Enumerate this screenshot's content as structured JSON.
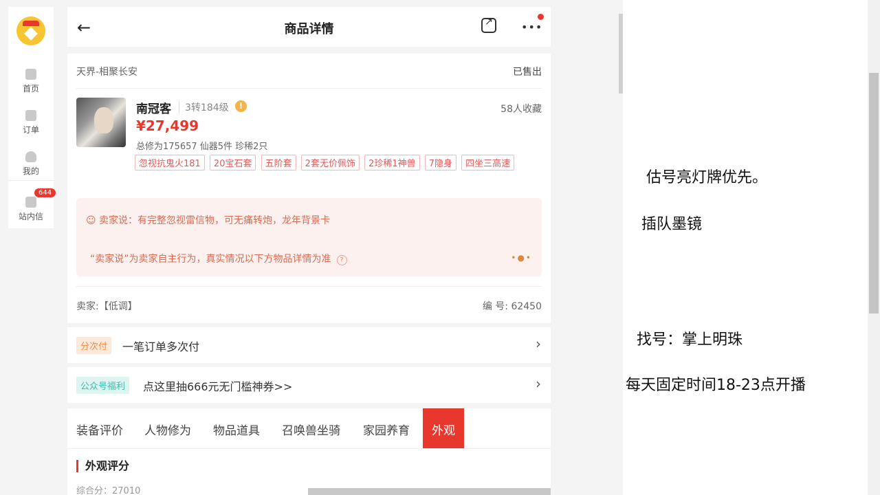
{
  "nav": {
    "items": [
      {
        "label": "首页",
        "icon": "home-icon"
      },
      {
        "label": "订单",
        "icon": "order-icon"
      },
      {
        "label": "我的",
        "icon": "user-icon"
      },
      {
        "label": "站内信",
        "icon": "mail-icon",
        "badge": "644"
      }
    ]
  },
  "header": {
    "title": "商品详情",
    "back_glyph": "←",
    "more_glyph": "•••"
  },
  "product": {
    "server": "天界-相聚长安",
    "status": "已售出",
    "name": "南冠客",
    "level": "3转184级",
    "favorites": "58人收藏",
    "price": "¥27,499",
    "stats": "总修为175657  仙器5件  珍稀2只",
    "tags": [
      "忽视抗鬼火181",
      "20宝石套",
      "五阶套",
      "2套无价佩饰",
      "2珍稀1神兽",
      "7隐身",
      "四坐三高速"
    ],
    "seller_says": "卖家说：有完整忽视雷信物，可无痛转炮，龙年背景卡",
    "seller_note": "“卖家说”为卖家自主行为，真实情况以下方物品详情为准",
    "seller_label": "卖家:【低调】",
    "serial": "编 号: 62450"
  },
  "installment": {
    "tag": "分次付",
    "text": "一笔订单多次付"
  },
  "promo": {
    "tag": "公众号福利",
    "text": "点这里抽666元无门槛神券>>"
  },
  "tabs": [
    "装备评价",
    "人物修为",
    "物品道具",
    "召唤兽坐骑",
    "家园养育",
    "外观"
  ],
  "active_tab": "外观",
  "section": {
    "title": "外观评分",
    "partial_line": "综合分：27010"
  },
  "notes": [
    "估号亮灯牌优先。",
    "插队墨镜",
    "找号：掌上明珠",
    "每天固定时间18-23点开播"
  ],
  "colors": {
    "accent": "#e8382d",
    "seller_box": "#fdf1ef",
    "tag_text": "#e05a5a"
  }
}
